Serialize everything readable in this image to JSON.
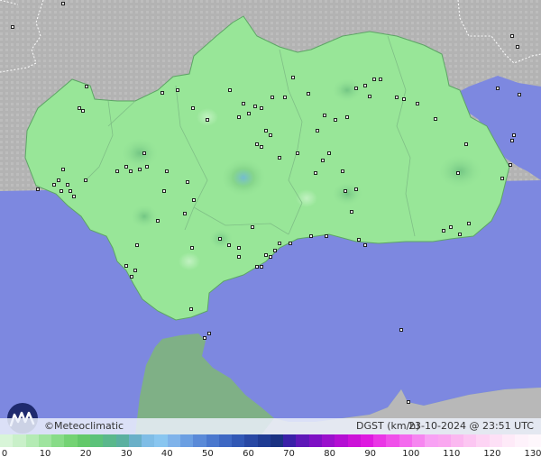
{
  "brand": {
    "copyright": "©",
    "name": "Meteoclimatic"
  },
  "product": {
    "label": "DGST (km/h)"
  },
  "timestamp": {
    "label": "23-10-2024 @ 23:51 UTC"
  },
  "legend": {
    "labels": [
      "0",
      "10",
      "20",
      "30",
      "40",
      "50",
      "60",
      "70",
      "80",
      "90",
      "100",
      "110",
      "120",
      "130"
    ],
    "colors": [
      "#d8f5d8",
      "#c9f0c9",
      "#b4ebb4",
      "#9ee49e",
      "#88dc88",
      "#74d374",
      "#64c96a",
      "#5cc27a",
      "#5ab88c",
      "#5ab0a0",
      "#6ab0c8",
      "#7fbde6",
      "#89c6f0",
      "#7fb3ea",
      "#6b9fe2",
      "#5a8ad8",
      "#4a78ce",
      "#3e68c3",
      "#3158b5",
      "#2848a4",
      "#1f3b93",
      "#1a3182",
      "#3a20a8",
      "#5e18b8",
      "#7e10c4",
      "#9a10cc",
      "#b40ed3",
      "#cc12d8",
      "#de1ae0",
      "#ea36e6",
      "#f050ea",
      "#f46aee",
      "#f686f0",
      "#f8a2f4",
      "#faa8f0",
      "#fbb8f0",
      "#fcc6f2",
      "#fdd4f4",
      "#fde0f6",
      "#feeaf8",
      "#fef2fb",
      "#fef7fc"
    ]
  },
  "colors": {
    "sea": "#7d88e0",
    "land": "#98e698",
    "land_dark": "#7fcf86",
    "outside": "#b5b5b5",
    "morocco": "#7fb086",
    "border": "#ffffff",
    "station": "#111111"
  },
  "icons": {
    "logo": "meteoclimatic-m-logo",
    "station": "station-marker"
  }
}
